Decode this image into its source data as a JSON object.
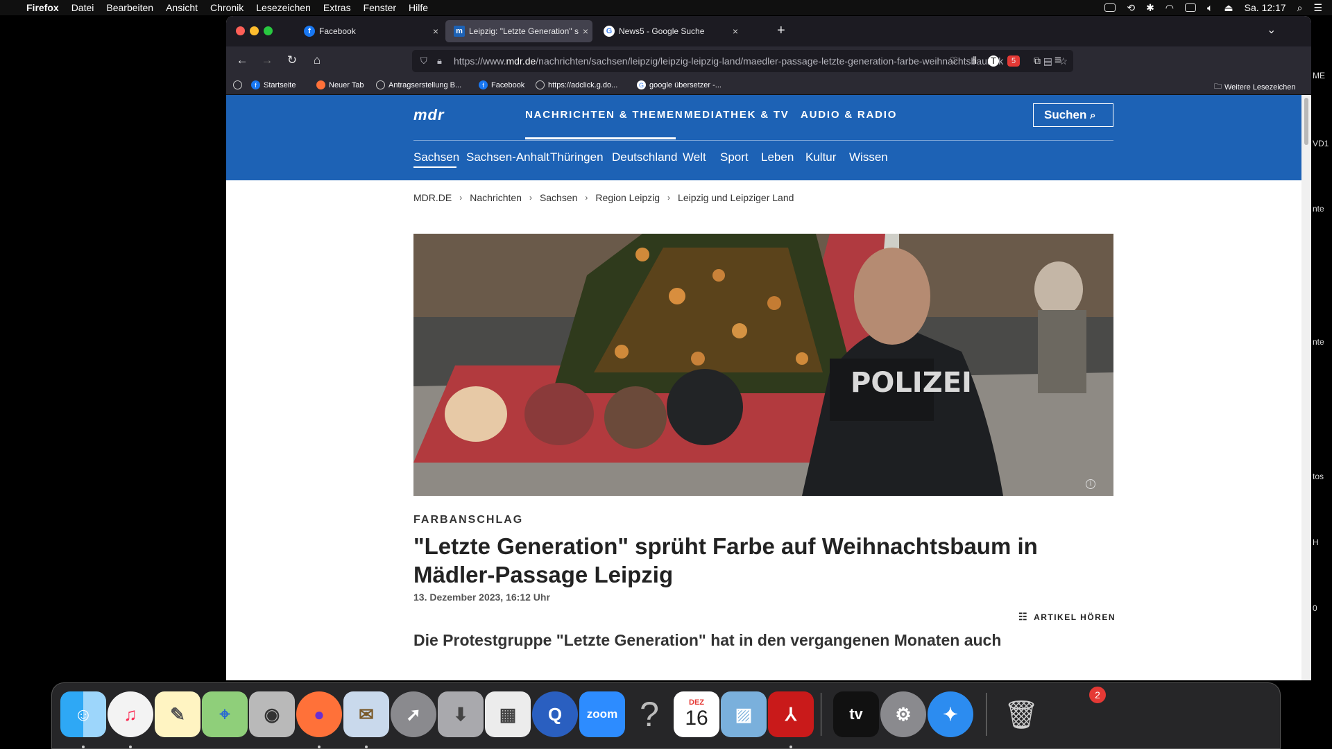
{
  "menubar": {
    "app": "Firefox",
    "items": [
      "Datei",
      "Bearbeiten",
      "Ansicht",
      "Chronik",
      "Lesezeichen",
      "Extras",
      "Fenster",
      "Hilfe"
    ],
    "clock": "Sa. 12:17"
  },
  "tabs": [
    {
      "label": "Facebook"
    },
    {
      "label": "Leipzig: \"Letzte Generation\" spr"
    },
    {
      "label": "News5 - Google Suche"
    }
  ],
  "url": {
    "prefix": "https://www.",
    "domain": "mdr.de",
    "path": "/nachrichten/sachsen/leipzig/leipzig-leipzig-land/maedler-passage-letzte-generation-farbe-weihnachtsbaum-k"
  },
  "bookmarks": [
    "Startseite",
    "Neuer Tab",
    "Antragserstellung B...",
    "Facebook",
    "https://adclick.g.do...",
    "google übersetzer -...",
    "Weitere Lesezeichen"
  ],
  "ext_badge": "5",
  "mdr": {
    "logo": "mdr",
    "mainnav": [
      "NACHRICHTEN & THEMEN",
      "MEDIATHEK & TV",
      "AUDIO & RADIO"
    ],
    "search": "Suchen",
    "subnav": [
      "Sachsen",
      "Sachsen-Anhalt",
      "Thüringen",
      "Deutschland",
      "Welt",
      "Sport",
      "Leben",
      "Kultur",
      "Wissen"
    ]
  },
  "breadcrumb": [
    "MDR.DE",
    "Nachrichten",
    "Sachsen",
    "Region Leipzig",
    "Leipzig und Leipziger Land"
  ],
  "article": {
    "kicker": "FARBANSCHLAG",
    "headline": "\"Letzte Generation\" sprüht Farbe auf Weihnachtsbaum in Mädler-Passage Leipzig",
    "date": "13. Dezember 2023, 16:12 Uhr",
    "listen": "ARTIKEL HÖREN",
    "lead": "Die Protestgruppe \"Letzte Generation\" hat in den vergangenen Monaten auch",
    "image_text": "POLIZEI"
  },
  "dock": {
    "calendar_month": "DEZ",
    "calendar_day": "16",
    "zoom": "zoom",
    "tv": "tv",
    "badge": "2"
  },
  "desktop_labels": [
    "ME",
    "VD1",
    "nte",
    "nte",
    "tos",
    "H",
    "0"
  ]
}
